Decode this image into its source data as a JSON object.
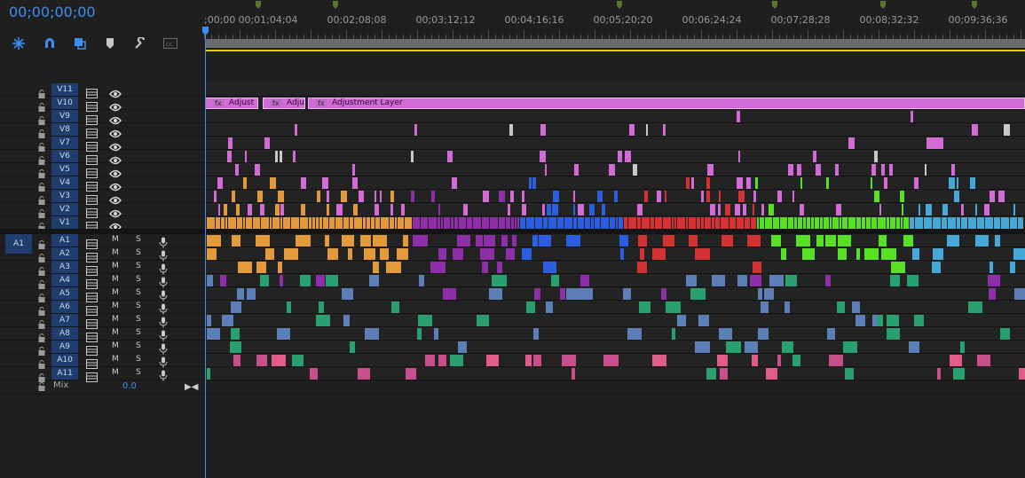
{
  "timecode": "00;00;00;00",
  "ruler": {
    "labels": [
      ";00;00",
      "00;01;04;04",
      "00;02;08;08",
      "00;03;12;12",
      "00;04;16;16",
      "00;05;20;20",
      "00;06;24;24",
      "00;07;28;28",
      "00;08;32;32",
      "00;09;36;36"
    ]
  },
  "toolbar": {
    "icons": [
      "snap-icon",
      "magnet-icon",
      "linked-selection-icon",
      "marker-icon",
      "wrench-icon",
      "captions-icon"
    ]
  },
  "video_tracks": [
    "V11",
    "V10",
    "V9",
    "V8",
    "V7",
    "V6",
    "V5",
    "V4",
    "V3",
    "V2",
    "V1"
  ],
  "audio_tracks": [
    "A1",
    "A2",
    "A3",
    "A4",
    "A5",
    "A6",
    "A7",
    "A8",
    "A9",
    "A10",
    "A11"
  ],
  "source_patch": "A1",
  "mute_label": "M",
  "solo_label": "S",
  "mix": {
    "label": "Mix",
    "value": "0.0"
  },
  "adjust_clips": [
    "Adjust",
    "Adju",
    "Adjustment Layer"
  ],
  "fx_label": "fx",
  "colors": {
    "accent": "#3a8ff0",
    "track_name_bg": "#1f3d6e",
    "adjustment": "#d26bd6",
    "orange": "#e39a3a",
    "purple": "#8e2ea8",
    "blue": "#2b5fe0",
    "red": "#d23232",
    "green": "#57e024",
    "cyan": "#45a8d6",
    "audio_green": "#28a070",
    "audio_pink": "#e05c8a",
    "audio_slate": "#5c7fb8",
    "audio_pink_dark": "#c94f8c"
  }
}
